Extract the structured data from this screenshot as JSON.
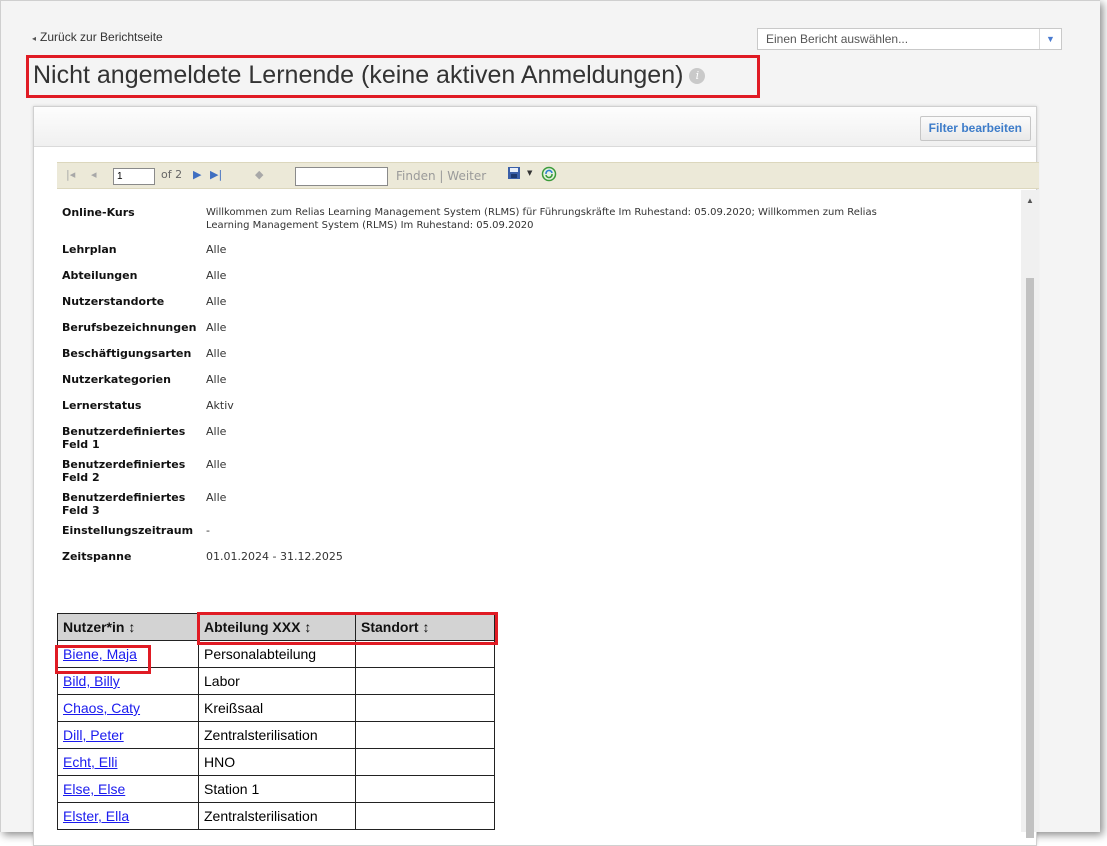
{
  "nav": {
    "back_label": "Zurück zur Berichtseite"
  },
  "report_select": {
    "placeholder": "Einen Bericht auswählen..."
  },
  "page": {
    "title": "Nicht angemeldete Lernende (keine aktiven Anmeldungen)",
    "info_icon": "info-icon"
  },
  "panel": {
    "filter_button": "Filter bearbeiten"
  },
  "toolbar": {
    "page_current": "1",
    "page_total": "of 2",
    "find_label": "Finden",
    "separator": "|",
    "next_label": "Weiter",
    "icons": [
      "first-page-icon",
      "prev-page-icon",
      "next-page-icon",
      "last-page-icon",
      "back-icon",
      "export-icon",
      "refresh-icon"
    ]
  },
  "params": [
    {
      "label": "Online-Kurs",
      "value": "Willkommen zum Relias Learning Management System (RLMS) für Führungskräfte Im Ruhestand: 05.09.2020; Willkommen zum Relias Learning Management System (RLMS) Im Ruhestand: 05.09.2020"
    },
    {
      "label": "Lehrplan",
      "value": "Alle"
    },
    {
      "label": "Abteilungen",
      "value": "Alle"
    },
    {
      "label": "Nutzerstandorte",
      "value": "Alle"
    },
    {
      "label": "Berufsbezeichnungen",
      "value": "Alle"
    },
    {
      "label": "Beschäftigungsarten",
      "value": "Alle"
    },
    {
      "label": "Nutzerkategorien",
      "value": "Alle"
    },
    {
      "label": "Lernerstatus",
      "value": "Aktiv"
    },
    {
      "label": "Benutzerdefiniertes Feld 1",
      "value": "Alle"
    },
    {
      "label": "Benutzerdefiniertes Feld 2",
      "value": "Alle"
    },
    {
      "label": "Benutzerdefiniertes Feld 3",
      "value": "Alle"
    },
    {
      "label": "Einstellungszeitraum",
      "value": "-"
    },
    {
      "label": "Zeitspanne",
      "value": "01.01.2024 - 31.12.2025"
    }
  ],
  "grid": {
    "headers": [
      "Nutzer*in ↕",
      "Abteilung XXX ↕",
      "Standort ↕"
    ],
    "rows": [
      {
        "user": "Biene, Maja",
        "department": "Personalabteilung",
        "location": ""
      },
      {
        "user": "Bild, Billy",
        "department": "Labor",
        "location": ""
      },
      {
        "user": "Chaos, Caty",
        "department": "Kreißsaal",
        "location": ""
      },
      {
        "user": "Dill, Peter",
        "department": "Zentralsterilisation",
        "location": ""
      },
      {
        "user": "Echt, Elli",
        "department": "HNO",
        "location": ""
      },
      {
        "user": "Else, Else",
        "department": "Station 1",
        "location": ""
      },
      {
        "user": "Elster, Ella",
        "department": "Zentralsterilisation",
        "location": ""
      }
    ]
  },
  "colors": {
    "highlight": "#e01b24",
    "link": "#1a1aee",
    "toolbar_bg": "#ece9d8",
    "accent": "#3d7cc9"
  }
}
